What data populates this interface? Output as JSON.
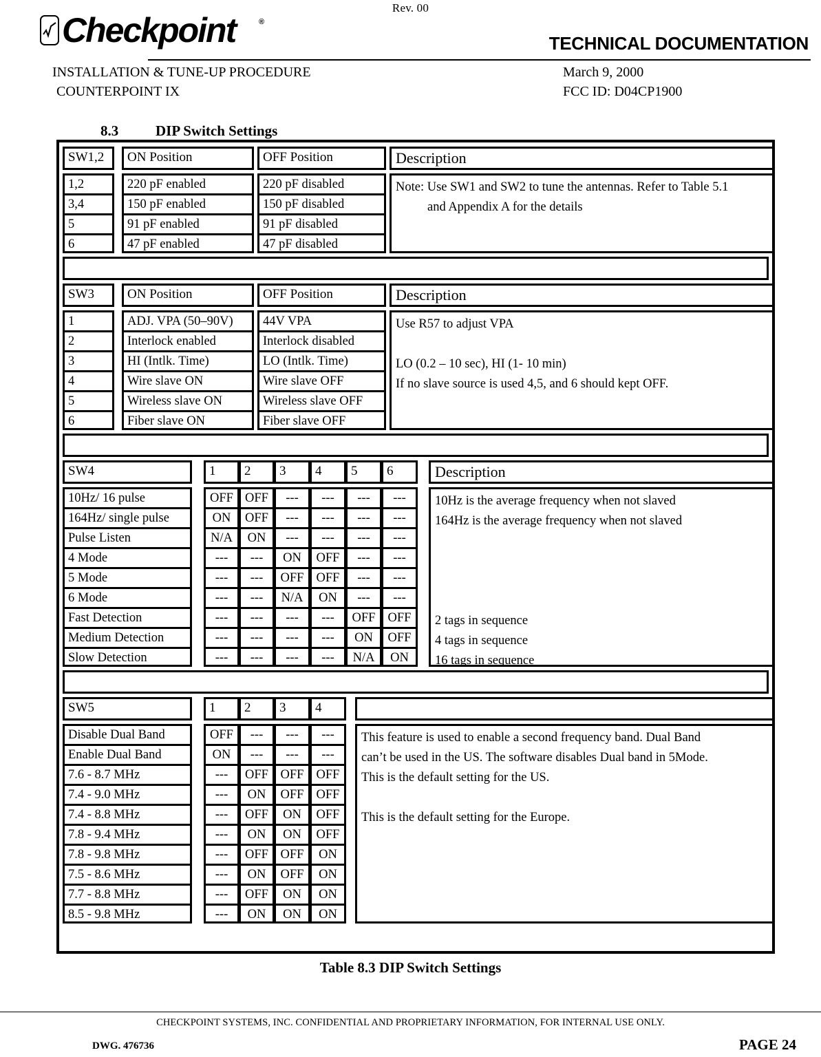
{
  "header": {
    "rev": "Rev. 00",
    "logo_word": "Checkpoint",
    "logo_reg": "®",
    "tech_doc": "TECHNICAL DOCUMENTATION",
    "left_line1": "INSTALLATION & TUNE-UP PROCEDURE",
    "left_line2": "COUNTERPOINT IX",
    "right_line1": "March 9, 2000",
    "right_line2": "FCC ID: D04CP1900"
  },
  "section": {
    "number": "8.3",
    "title": "DIP Switch Settings"
  },
  "sw12": {
    "head": {
      "sw": "SW1,2",
      "on": "ON Position",
      "off": "OFF Position",
      "desc": "Description"
    },
    "switches": [
      "1,2",
      "3,4",
      "5",
      "6"
    ],
    "on_values": [
      "220 pF enabled",
      "150 pF enabled",
      "91   pF enabled",
      "47   pF enabled"
    ],
    "off_values": [
      "220 pF disabled",
      "150 pF disabled",
      "91   pF disabled",
      "47   pF disabled"
    ],
    "desc_lines": [
      "Note: Use SW1 and SW2 to tune the antennas. Refer to Table 5.1",
      "and Appendix A for the details"
    ]
  },
  "sw3": {
    "head": {
      "sw": "SW3",
      "on": "ON Position",
      "off": "OFF Position",
      "desc": "Description"
    },
    "switches": [
      "1",
      "2",
      "3",
      "4",
      "5",
      "6"
    ],
    "on_values": [
      "ADJ. VPA (50–90V)",
      "Interlock enabled",
      "HI (Intlk. Time)",
      "Wire slave ON",
      "Wireless slave ON",
      "Fiber slave ON"
    ],
    "off_values": [
      "44V VPA",
      "Interlock disabled",
      "LO (Intlk. Time)",
      "Wire slave OFF",
      "Wireless slave OFF",
      "Fiber slave OFF"
    ],
    "desc_lines": [
      "Use R57 to adjust VPA",
      "",
      "LO (0.2 – 10 sec),   HI (1- 10 min)",
      "If no slave source is used 4,5, and 6 should kept OFF."
    ]
  },
  "sw4": {
    "head": {
      "sw": "SW4",
      "desc": "Description"
    },
    "pins": [
      "1",
      "2",
      "3",
      "4",
      "5",
      "6"
    ],
    "rows": [
      {
        "label": "10Hz/ 16 pulse",
        "values": [
          "OFF",
          "OFF",
          "---",
          "---",
          "---",
          "---"
        ],
        "desc": "10Hz is the average frequency when not slaved"
      },
      {
        "label": "164Hz/ single pulse",
        "values": [
          "ON",
          "OFF",
          "---",
          "---",
          "---",
          "---"
        ],
        "desc": "164Hz is the average frequency when not slaved"
      },
      {
        "label": "Pulse Listen",
        "values": [
          "N/A",
          "ON",
          "---",
          "---",
          "---",
          "---"
        ],
        "desc": ""
      },
      {
        "label": "4  Mode",
        "values": [
          "---",
          "---",
          "ON",
          "OFF",
          "---",
          "---"
        ],
        "desc": ""
      },
      {
        "label": "5  Mode",
        "values": [
          "---",
          "---",
          "OFF",
          "OFF",
          "---",
          "---"
        ],
        "desc": ""
      },
      {
        "label": "6  Mode",
        "values": [
          "---",
          "---",
          "N/A",
          "ON",
          "---",
          "---"
        ],
        "desc": ""
      },
      {
        "label": "Fast Detection",
        "values": [
          "---",
          "---",
          "---",
          "---",
          "OFF",
          "OFF"
        ],
        "desc": "2 tags in sequence"
      },
      {
        "label": "Medium Detection",
        "values": [
          "---",
          "---",
          "---",
          "---",
          "ON",
          "OFF"
        ],
        "desc": "4 tags in sequence"
      },
      {
        "label": "Slow Detection",
        "values": [
          "---",
          "---",
          "---",
          "---",
          "N/A",
          "ON"
        ],
        "desc": "16 tags in sequence"
      }
    ]
  },
  "sw5": {
    "head": {
      "sw": "SW5",
      "desc": ""
    },
    "pins": [
      "1",
      "2",
      "3",
      "4"
    ],
    "rows": [
      {
        "label": "Disable Dual Band",
        "values": [
          "OFF",
          "---",
          "---",
          "---"
        ]
      },
      {
        "label": "Enable Dual Band",
        "values": [
          "ON",
          "---",
          "---",
          "---"
        ]
      },
      {
        "label": "7.6 - 8.7 MHz",
        "values": [
          "---",
          "OFF",
          "OFF",
          "OFF"
        ]
      },
      {
        "label": "7.4 - 9.0 MHz",
        "values": [
          "---",
          "ON",
          "OFF",
          "OFF"
        ]
      },
      {
        "label": "7.4 - 8.8 MHz",
        "values": [
          "---",
          "OFF",
          "ON",
          "OFF"
        ]
      },
      {
        "label": "7.8 - 9.4 MHz",
        "values": [
          "---",
          "ON",
          "ON",
          "OFF"
        ]
      },
      {
        "label": "7.8 - 9.8 MHz",
        "values": [
          "---",
          "OFF",
          "OFF",
          "ON"
        ]
      },
      {
        "label": "7.5 - 8.6 MHz",
        "values": [
          "---",
          "ON",
          "OFF",
          "ON"
        ]
      },
      {
        "label": "7.7 - 8.8 MHz",
        "values": [
          "---",
          "OFF",
          "ON",
          "ON"
        ]
      },
      {
        "label": "8.5 - 9.8 MHz",
        "values": [
          "---",
          "ON",
          "ON",
          "ON"
        ]
      }
    ],
    "desc_lines": [
      "This feature is used to enable a second frequency band. Dual Band",
      "can’t be used in the US. The software disables Dual band in 5Mode.",
      " This is the default setting for the US.",
      "",
      "This is the default setting for the Europe."
    ]
  },
  "caption": "Table 8.3  DIP Switch Settings",
  "footer": {
    "confidential": "CHECKPOINT SYSTEMS, INC. CONFIDENTIAL AND PROPRIETARY INFORMATION, FOR INTERNAL USE ONLY.",
    "dwg": "DWG.  476736",
    "page": "PAGE 24"
  }
}
